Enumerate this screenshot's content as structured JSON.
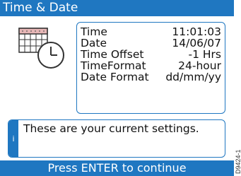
{
  "title": "Time & Date",
  "icon": "calendar-clock-icon",
  "settings": [
    {
      "label": "Time",
      "value": "11:01:03"
    },
    {
      "label": "Date",
      "value": "14/06/07"
    },
    {
      "label": "Time Offset",
      "value": "-1 Hrs"
    },
    {
      "label": "TimeFormat",
      "value": "24-hour"
    },
    {
      "label": "Date Format",
      "value": "dd/mm/yy"
    }
  ],
  "message": {
    "icon_label": "i",
    "text": "These are your current settings."
  },
  "prompt": "Press ENTER to continue",
  "figure_id": "D9424-1",
  "colors": {
    "accent": "#1f77c1",
    "background": "#ffffff",
    "text": "#111111"
  }
}
